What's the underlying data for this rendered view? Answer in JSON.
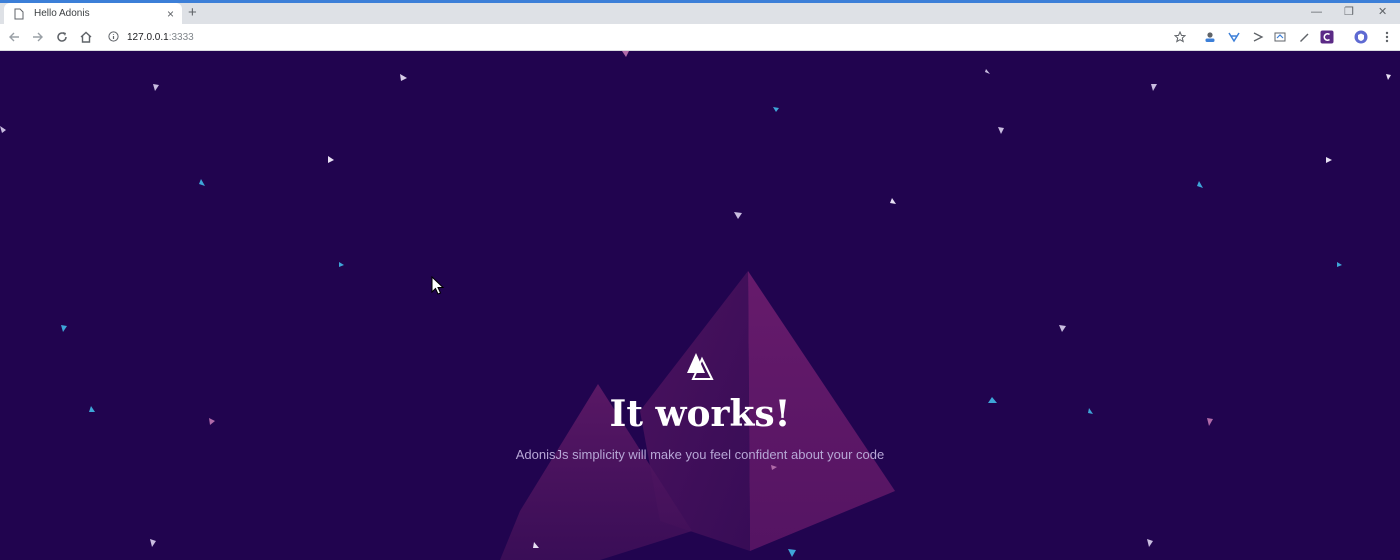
{
  "browser": {
    "tab": {
      "title": "Hello Adonis",
      "close_label": "×"
    },
    "new_tab_label": "+",
    "window_controls": {
      "minimize": "—",
      "restore": "❐",
      "close": "✕"
    },
    "address": {
      "host": "127.0.0.1",
      "port": ":3333"
    },
    "icons": [
      "back-icon",
      "forward-icon",
      "reload-icon",
      "home-icon",
      "info-icon",
      "star-icon",
      "extension-icons",
      "menu-icon"
    ]
  },
  "page": {
    "title": "It works!",
    "subtitle": "AdonisJs simplicity will make you feel confident about your code",
    "colors": {
      "background": "#21044f",
      "pyramid": "#7a1f70",
      "accent_blue": "#3ea6d8",
      "accent_pink": "#b06aa8"
    }
  }
}
